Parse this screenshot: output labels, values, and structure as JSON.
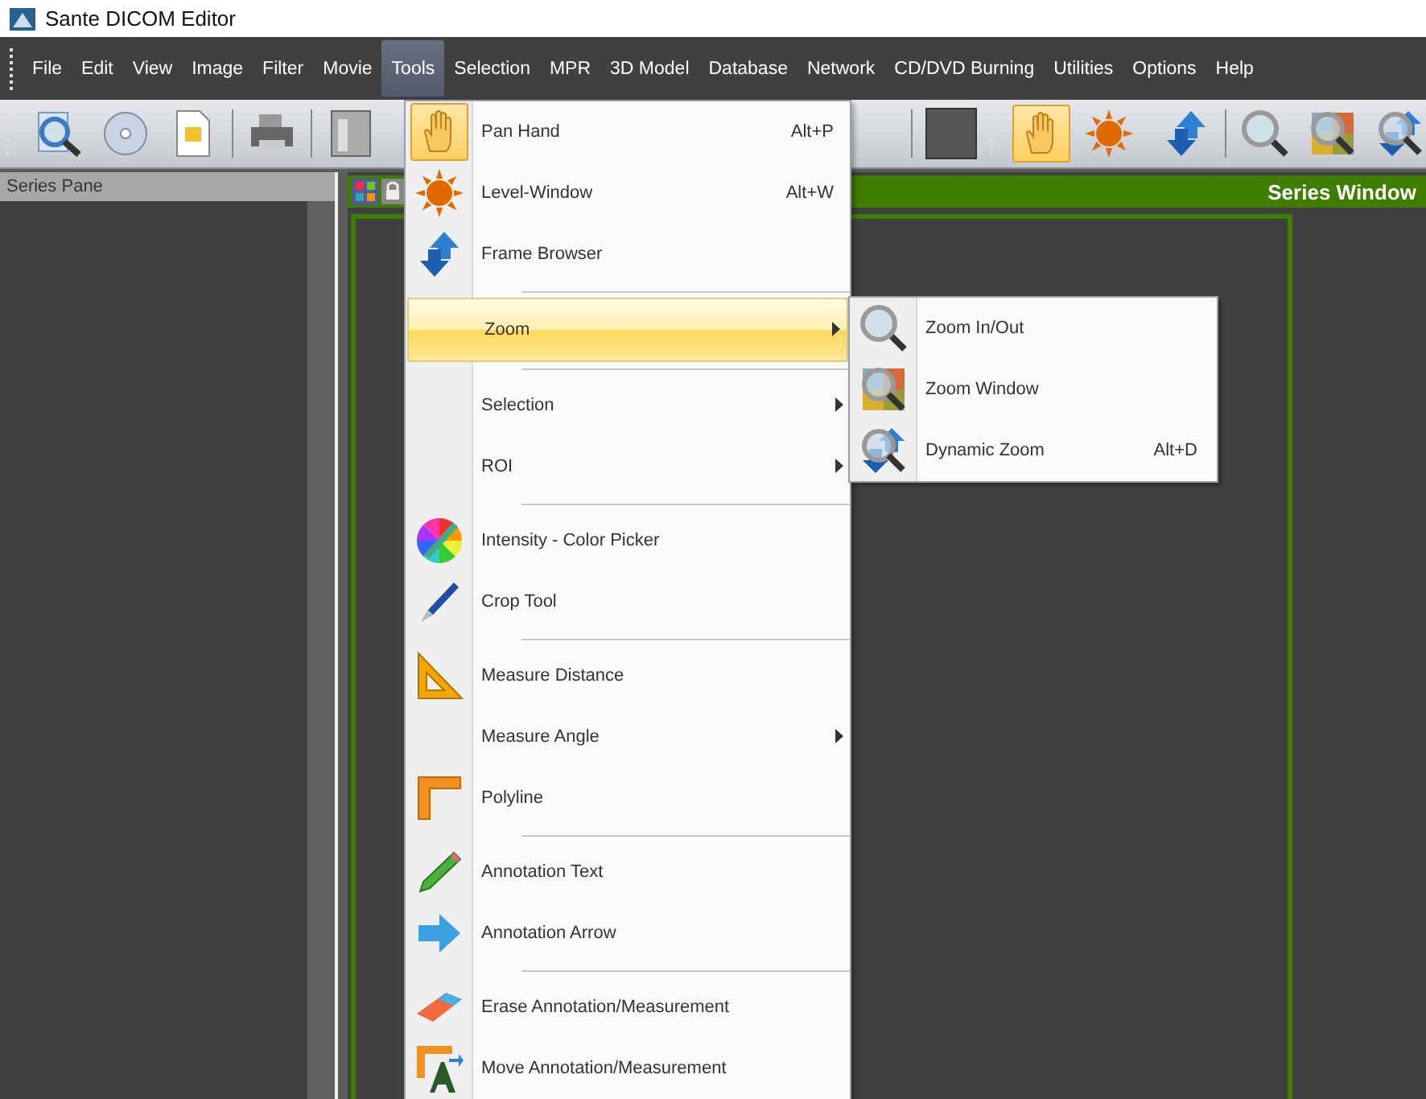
{
  "window": {
    "title": "Sante DICOM Editor"
  },
  "menubar": [
    {
      "label": "File",
      "selected": false
    },
    {
      "label": "Edit",
      "selected": false
    },
    {
      "label": "View",
      "selected": false
    },
    {
      "label": "Image",
      "selected": false
    },
    {
      "label": "Filter",
      "selected": false
    },
    {
      "label": "Movie",
      "selected": false
    },
    {
      "label": "Tools",
      "selected": true
    },
    {
      "label": "Selection",
      "selected": false
    },
    {
      "label": "MPR",
      "selected": false
    },
    {
      "label": "3D Model",
      "selected": false
    },
    {
      "label": "Database",
      "selected": false
    },
    {
      "label": "Network",
      "selected": false
    },
    {
      "label": "CD/DVD Burning",
      "selected": false
    },
    {
      "label": "Utilities",
      "selected": false
    },
    {
      "label": "Options",
      "selected": false
    },
    {
      "label": "Help",
      "selected": false
    }
  ],
  "toolbar": {
    "left": [
      {
        "selected": false
      },
      {
        "selected": false
      },
      {
        "selected": false
      },
      {
        "selected": false
      },
      {
        "selected": false
      }
    ],
    "right": [
      {
        "selected": true
      },
      {
        "selected": false
      },
      {
        "selected": false
      },
      {
        "selected": false
      },
      {
        "selected": false
      },
      {
        "selected": false
      }
    ]
  },
  "series_pane": {
    "title": "Series Pane"
  },
  "series_window": {
    "title": "Series Window"
  },
  "tools_menu": {
    "groups": [
      [
        {
          "label": "Pan Hand",
          "shortcut": "Alt+P",
          "checked": true,
          "selected": false,
          "submenu": false
        },
        {
          "label": "Level-Window",
          "shortcut": "Alt+W",
          "checked": false,
          "selected": false,
          "submenu": false
        },
        {
          "label": "Frame Browser",
          "checked": false,
          "selected": false,
          "submenu": false
        }
      ],
      [
        {
          "label": "Zoom",
          "checked": false,
          "selected": true,
          "submenu": true
        }
      ],
      [
        {
          "label": "Selection",
          "checked": false,
          "selected": false,
          "submenu": true
        },
        {
          "label": "ROI",
          "checked": false,
          "selected": false,
          "submenu": true
        }
      ],
      [
        {
          "label": "Intensity - Color Picker",
          "checked": false,
          "selected": false,
          "submenu": false
        },
        {
          "label": "Crop Tool",
          "checked": false,
          "selected": false,
          "submenu": false
        }
      ],
      [
        {
          "label": "Measure Distance",
          "checked": false,
          "selected": false,
          "submenu": false
        },
        {
          "label": "Measure Angle",
          "checked": false,
          "selected": false,
          "submenu": true
        },
        {
          "label": "Polyline",
          "checked": false,
          "selected": false,
          "submenu": false
        }
      ],
      [
        {
          "label": "Annotation Text",
          "checked": false,
          "selected": false,
          "submenu": false
        },
        {
          "label": "Annotation Arrow",
          "checked": false,
          "selected": false,
          "submenu": false
        }
      ],
      [
        {
          "label": "Erase Annotation/Measurement",
          "checked": false,
          "selected": false,
          "submenu": false
        },
        {
          "label": "Move Annotation/Measurement",
          "checked": false,
          "selected": false,
          "submenu": false
        }
      ]
    ]
  },
  "zoom_submenu": {
    "items": [
      {
        "label": "Zoom In/Out"
      },
      {
        "label": "Zoom Window"
      },
      {
        "label": "Dynamic Zoom",
        "shortcut": "Alt+D"
      }
    ]
  }
}
